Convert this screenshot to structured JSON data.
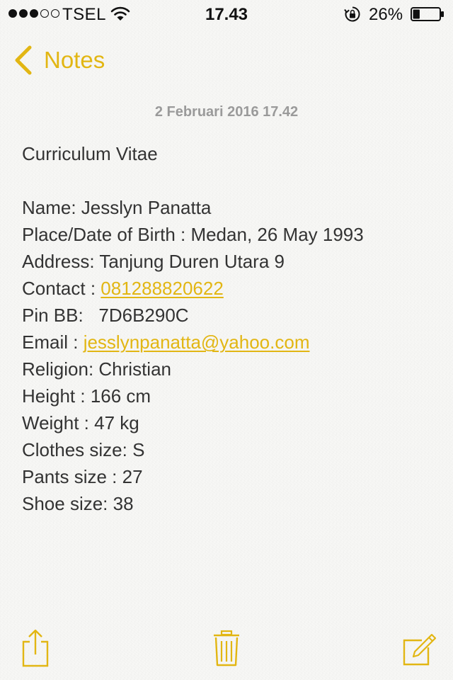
{
  "status_bar": {
    "carrier": "TSEL",
    "time": "17.43",
    "battery_percent": "26%",
    "battery_level": 0.26,
    "signal_bars_filled": 3,
    "signal_bars_total": 5,
    "icons": [
      "signal-dots-icon",
      "wifi-icon",
      "orientation-lock-icon",
      "battery-icon"
    ]
  },
  "nav": {
    "back_label": "Notes",
    "back_icon": "chevron-left-icon"
  },
  "note": {
    "date": "2 Februari 2016 17.42",
    "title": "Curriculum Vitae",
    "fields": {
      "name": "Name: Jesslyn Panatta",
      "birth": "Place/Date of Birth : Medan, 26 May 1993",
      "address": "Address: Tanjung Duren Utara 9",
      "contact_label": "Contact : ",
      "contact_value": "081288820622",
      "pin_bb": "Pin BB:   7D6B290C",
      "email_label": "Email : ",
      "email_value": "jesslynpanatta@yahoo.com",
      "religion": "Religion: Christian",
      "height": "Height : 166 cm",
      "weight": "Weight : 47 kg",
      "clothes_size": "Clothes size: S",
      "pants_size": "Pants size : 27",
      "shoe_size": "Shoe size: 38"
    }
  },
  "toolbar": {
    "icons": [
      "share-icon",
      "trash-icon",
      "compose-icon"
    ]
  },
  "colors": {
    "accent": "#e2b613",
    "text": "#333333",
    "date": "#9a9a9a",
    "background": "#f7f7f5"
  }
}
